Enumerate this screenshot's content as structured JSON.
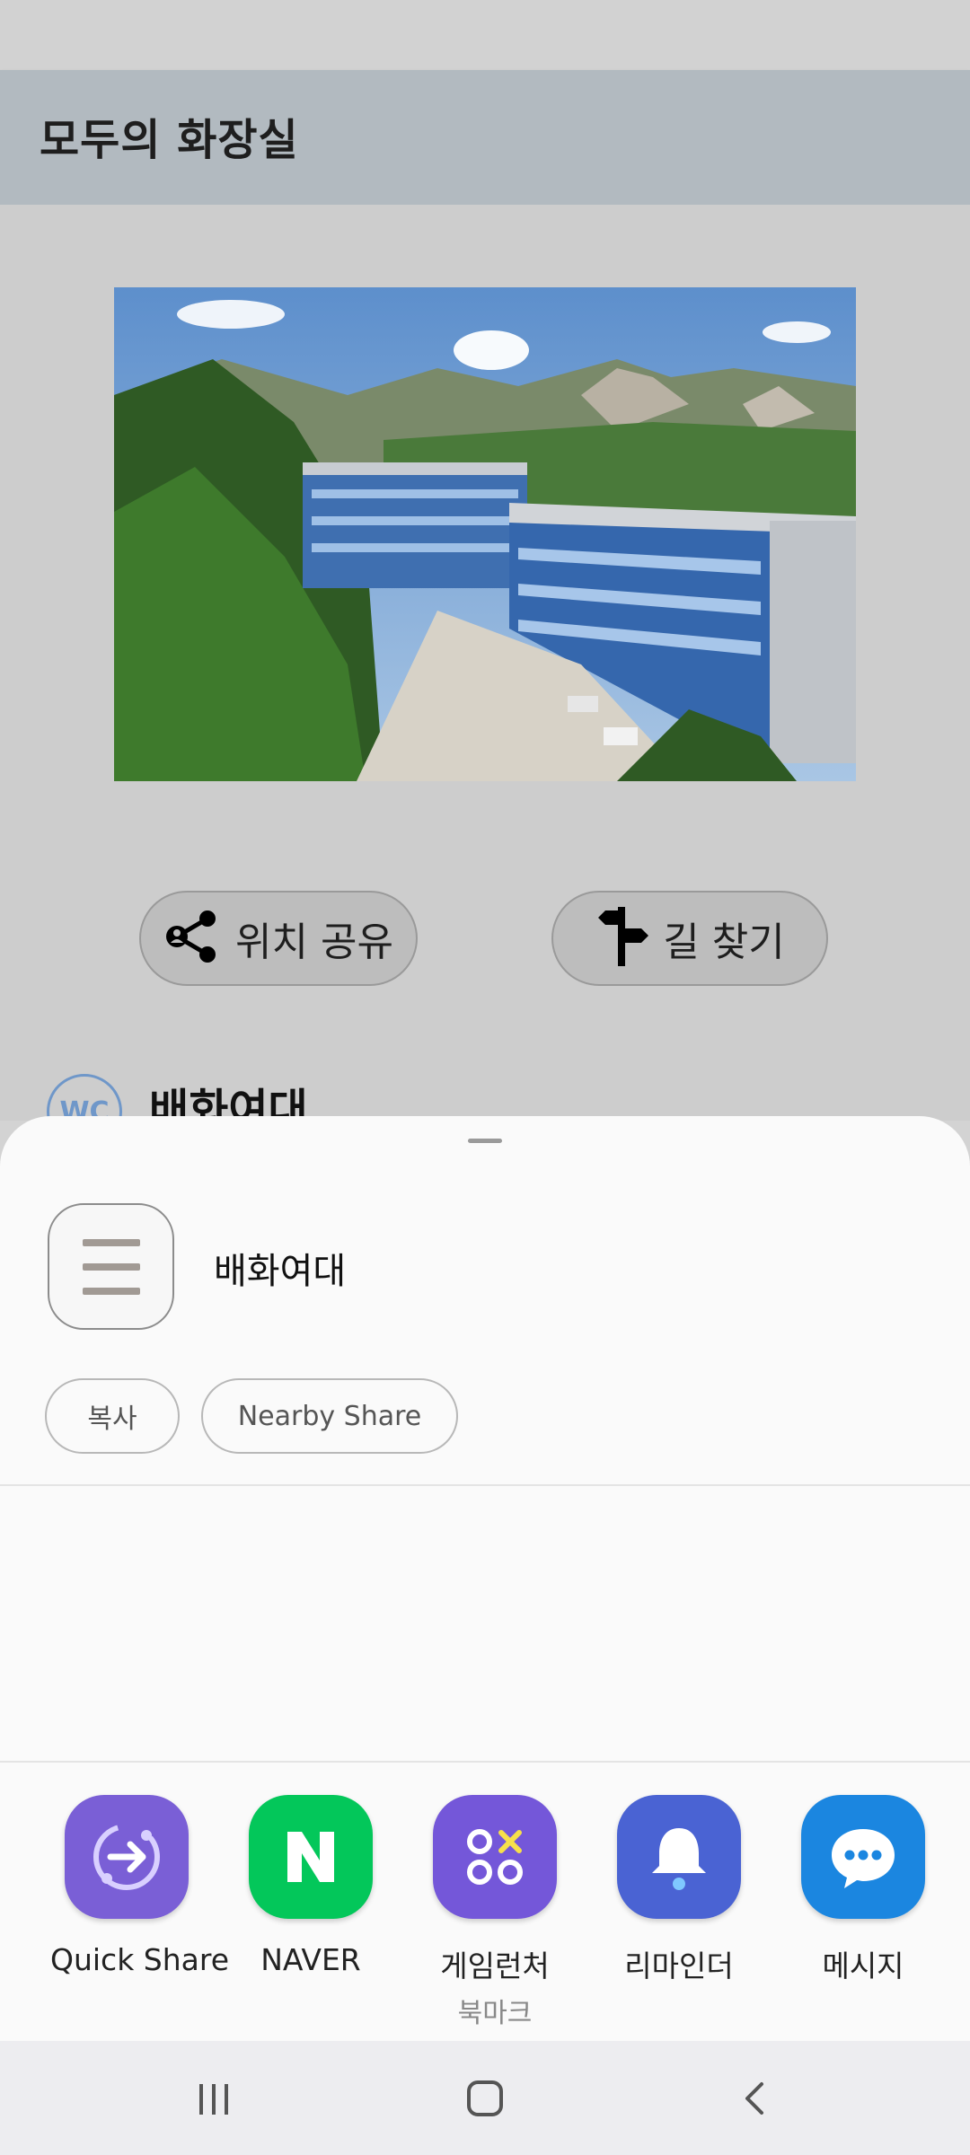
{
  "app": {
    "title": "모두의 화장실"
  },
  "actions": {
    "share_label": "위치 공유",
    "route_label": "길 찾기"
  },
  "place": {
    "logo_text": "WC",
    "name": "배화여대"
  },
  "share_sheet": {
    "preview_text": "배화여대",
    "chips": {
      "copy": "복사",
      "nearby": "Nearby Share"
    },
    "apps": [
      {
        "name": "Quick Share",
        "sublabel": "",
        "icon": "quick-share-icon",
        "color": "#7a5fd6"
      },
      {
        "name": "NAVER",
        "sublabel": "",
        "icon": "naver-icon",
        "color": "#03c75a"
      },
      {
        "name": "게임런처",
        "sublabel": "북마크",
        "icon": "game-launcher-icon",
        "color": "#7457d9"
      },
      {
        "name": "리마인더",
        "sublabel": "",
        "icon": "reminder-bell-icon",
        "color": "#4a63d3"
      },
      {
        "name": "메시지",
        "sublabel": "",
        "icon": "message-bubble-icon",
        "color": "#1b86e0"
      }
    ]
  },
  "navbar": {
    "recents": "recents-icon",
    "home": "home-icon",
    "back": "back-icon"
  }
}
